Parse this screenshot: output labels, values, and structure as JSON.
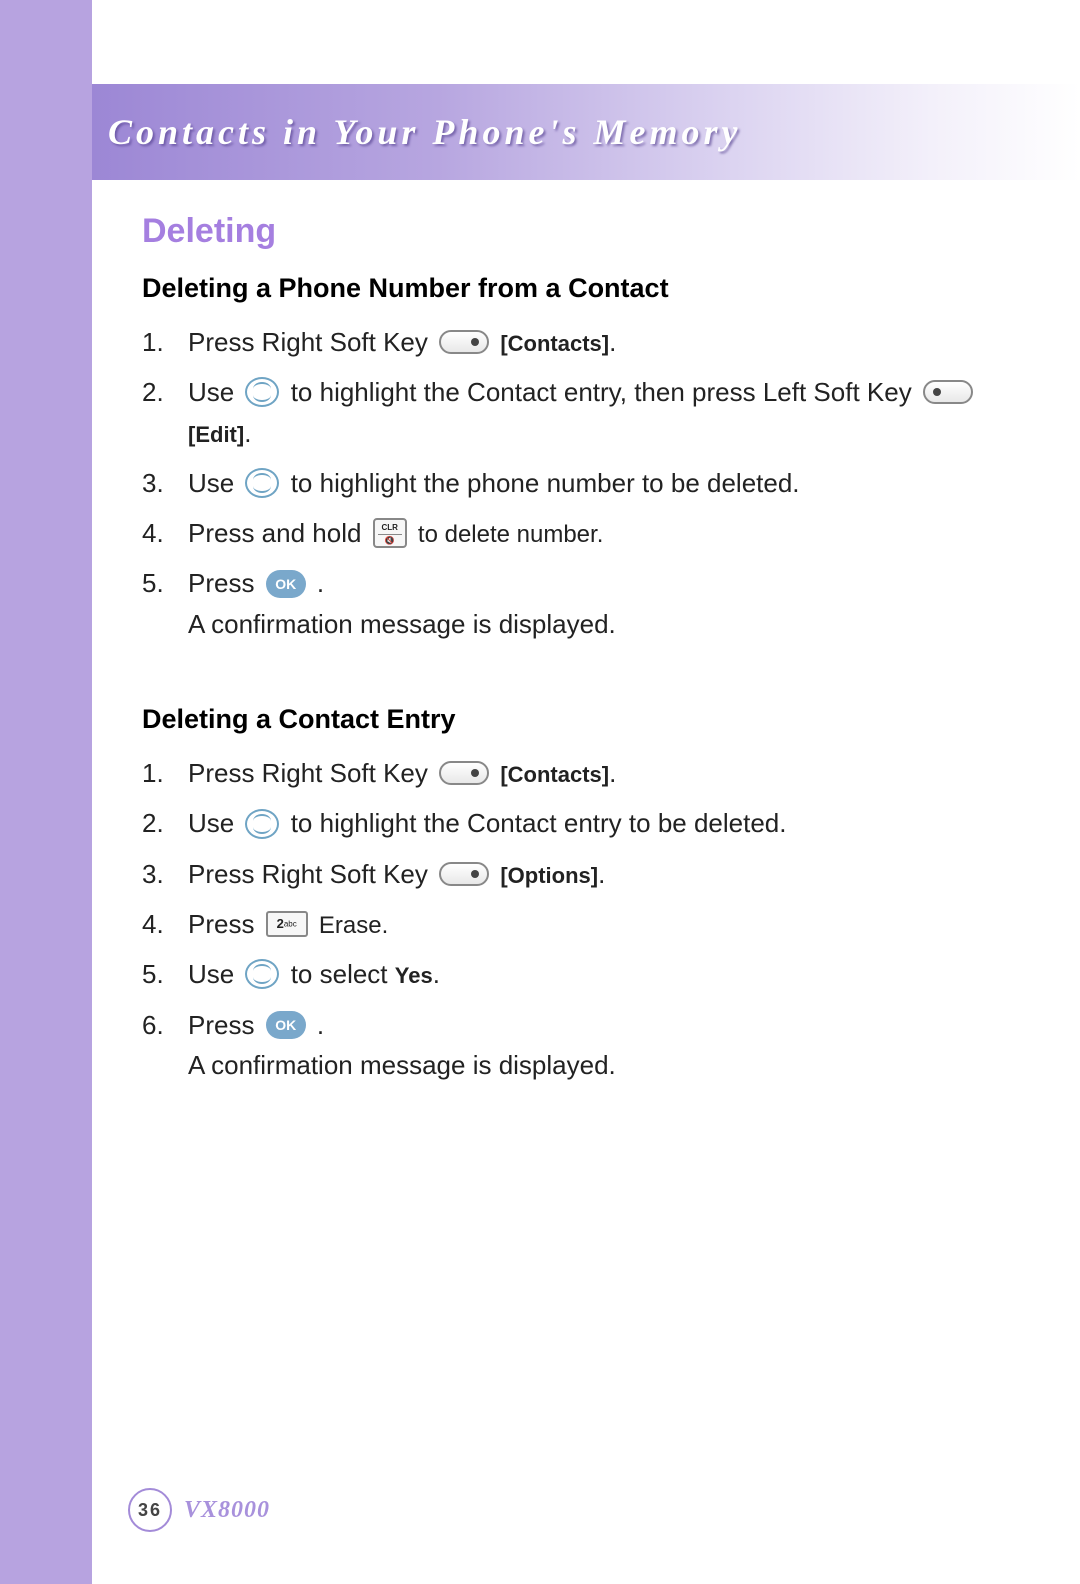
{
  "header": {
    "title": "Contacts in Your Phone's Memory"
  },
  "section": {
    "title": "Deleting"
  },
  "block1": {
    "title": "Deleting a Phone Number from a Contact",
    "steps": {
      "s1_pre": "Press Right Soft Key ",
      "s1_label": "[Contacts]",
      "s1_post": ".",
      "s2_pre": "Use ",
      "s2_mid": " to highlight the Contact entry, then press Left Soft Key ",
      "s2_label": "[Edit]",
      "s2_post": ".",
      "s3_pre": "Use ",
      "s3_post": " to highlight the phone number to be deleted.",
      "s4_pre": "Press and hold ",
      "s4_post": " to delete number.",
      "s5_pre": "Press ",
      "s5_post": " .",
      "s5_conf": "A confirmation message is displayed."
    }
  },
  "block2": {
    "title": "Deleting a Contact Entry",
    "steps": {
      "s1_pre": "Press Right Soft Key ",
      "s1_label": "[Contacts]",
      "s1_post": ".",
      "s2_pre": "Use ",
      "s2_post": " to highlight the Contact entry to be deleted.",
      "s3_pre": "Press Right Soft Key ",
      "s3_label": "[Options]",
      "s3_post": ".",
      "s4_pre": "Press ",
      "s4_post": " Erase.",
      "s5_pre": "Use ",
      "s5_mid": " to select ",
      "s5_yes": "Yes",
      "s5_post": ".",
      "s6_pre": "Press ",
      "s6_post": " .",
      "s6_conf": "A confirmation message is displayed."
    }
  },
  "icons": {
    "clr_top": "CLR",
    "ok": "OK",
    "numkey": "2",
    "numkey_sub": "abc"
  },
  "footer": {
    "page": "36",
    "model": "VX8000"
  }
}
